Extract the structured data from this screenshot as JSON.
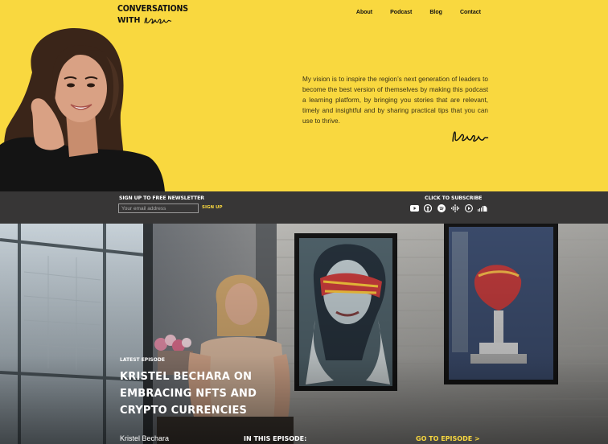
{
  "header": {
    "logo_line1": "CONVERSATIONS",
    "logo_with": "WITH",
    "nav": [
      "About",
      "Podcast",
      "Blog",
      "Contact"
    ]
  },
  "hero": {
    "vision": "My vision is to inspire the region’s next generation of leaders to become the best version of themselves by making this podcast a learning platform, by bringing you stories that are relevant, timely and insightful and by sharing practical tips that you can use to thrive."
  },
  "newsletter": {
    "title": "SIGN UP TO FREE NEWSLETTER",
    "placeholder": "Your email address",
    "button": "SIGN UP"
  },
  "subscribe": {
    "title": "CLICK TO SUBSCRIBE",
    "icons": [
      "youtube-icon",
      "apple-podcasts-icon",
      "spotify-icon",
      "google-podcasts-icon",
      "play-circle-icon",
      "soundcloud-icon"
    ]
  },
  "episode": {
    "latest_label": "LATEST EPISODE",
    "title": "KRISTEL BECHARA ON EMBRACING NFTS AND CRYPTO CURRENCIES",
    "guest": "Kristel Bechara",
    "in_this": "IN THIS EPISODE:",
    "goto": "GO TO EPISODE >"
  },
  "colors": {
    "brand_yellow": "#f9d83f",
    "bar_dark": "#373636"
  }
}
